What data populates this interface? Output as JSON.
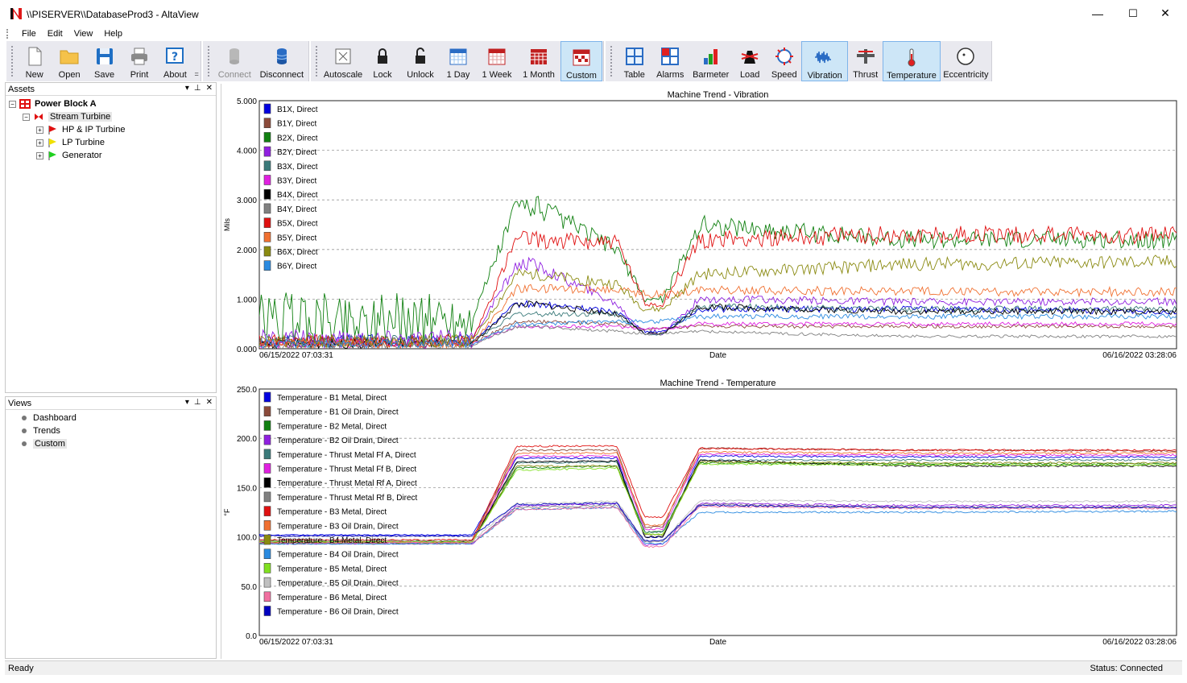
{
  "window": {
    "title": "\\\\PISERVER\\\\DatabaseProd3 - AltaView",
    "minimize": "—",
    "maximize": "☐",
    "close": "✕"
  },
  "menu": [
    "File",
    "Edit",
    "View",
    "Help"
  ],
  "toolbar": {
    "file_group": [
      {
        "label": "New",
        "icon": "new-document-icon"
      },
      {
        "label": "Open",
        "icon": "folder-icon"
      },
      {
        "label": "Save",
        "icon": "floppy-icon"
      },
      {
        "label": "Print",
        "icon": "printer-icon"
      },
      {
        "label": "About",
        "icon": "help-icon"
      }
    ],
    "overflow": "=",
    "connection_group": [
      {
        "label": "Connect",
        "icon": "database-icon",
        "disabled": true
      },
      {
        "label": "Disconnect",
        "icon": "database-icon",
        "disabled": false
      }
    ],
    "view_group": [
      {
        "label": "Autoscale",
        "icon": "autoscale-icon"
      },
      {
        "label": "Lock",
        "icon": "lock-icon"
      },
      {
        "label": "Unlock",
        "icon": "unlock-icon"
      },
      {
        "label": "1 Day",
        "icon": "calendar-day-icon"
      },
      {
        "label": "1 Week",
        "icon": "calendar-week-icon"
      },
      {
        "label": "1 Month",
        "icon": "calendar-month-icon"
      },
      {
        "label": "Custom",
        "icon": "calendar-custom-icon",
        "active": true
      }
    ],
    "display_group": [
      {
        "label": "Table",
        "icon": "table-icon"
      },
      {
        "label": "Alarms",
        "icon": "alarms-icon"
      },
      {
        "label": "Barmeter",
        "icon": "barmeter-icon"
      },
      {
        "label": "Load",
        "icon": "load-icon"
      },
      {
        "label": "Speed",
        "icon": "speed-icon"
      },
      {
        "label": "Vibration",
        "icon": "vibration-icon",
        "active": true
      },
      {
        "label": "Thrust",
        "icon": "thrust-icon"
      },
      {
        "label": "Temperature",
        "icon": "thermometer-icon",
        "active": true
      },
      {
        "label": "Eccentricity",
        "icon": "eccentricity-icon"
      }
    ]
  },
  "assets_panel": {
    "title": "Assets",
    "tree": [
      {
        "label": "Power Block A",
        "level": 0,
        "expander": "−",
        "color": "#e01010",
        "bold": true
      },
      {
        "label": "Stream Turbine",
        "level": 1,
        "expander": "−",
        "color": "#e01010",
        "selected": true
      },
      {
        "label": "HP & IP Turbine",
        "level": 2,
        "expander": "+",
        "color": "#e01010"
      },
      {
        "label": "LP Turbine",
        "level": 2,
        "expander": "+",
        "color": "#f0e000"
      },
      {
        "label": "Generator",
        "level": 2,
        "expander": "+",
        "color": "#20d020"
      }
    ]
  },
  "views_panel": {
    "title": "Views",
    "items": [
      "Dashboard",
      "Trends",
      "Custom"
    ]
  },
  "panel_controls": {
    "dropdown": "▾",
    "pin": "📌",
    "close": "✕"
  },
  "charts": {
    "vibration": {
      "title": "Machine Trend - Vibration",
      "ylabel": "Mils",
      "xlabel": "Date",
      "x_start": "06/15/2022 07:03:31",
      "x_end": "06/16/2022 03:28:06",
      "yticks": [
        "5.000",
        "4.000",
        "3.000",
        "2.000",
        "1.000",
        "0.000"
      ]
    },
    "temperature": {
      "title": "Machine Trend - Temperature",
      "ylabel": "°F",
      "xlabel": "Date",
      "x_start": "06/15/2022 07:03:31",
      "x_end": "06/16/2022 03:28:06",
      "yticks": [
        "250.0",
        "200.0",
        "150.0",
        "100.0",
        "50.0",
        "0.0"
      ]
    }
  },
  "chart_data": [
    {
      "type": "line",
      "title": "Machine Trend - Vibration",
      "xlabel": "Date",
      "ylabel": "Mils",
      "ylim": [
        0,
        5
      ],
      "x_range": [
        "06/15/2022 07:03:31",
        "06/16/2022 03:28:06"
      ],
      "grid": "horizontal-dashed",
      "legend": "top-left",
      "series": [
        {
          "name": "B1X, Direct",
          "color": "#0000e0",
          "values": [
            0.15,
            0.9,
            0.75,
            0.35,
            0.8,
            0.8,
            0.75
          ]
        },
        {
          "name": "B1Y, Direct",
          "color": "#8b4a3a",
          "values": [
            0.12,
            0.55,
            0.5,
            0.4,
            0.45,
            0.45,
            0.45
          ]
        },
        {
          "name": "B2X, Direct",
          "color": "#108010",
          "values": [
            0.6,
            2.9,
            2.0,
            1.0,
            2.5,
            2.2,
            2.2
          ]
        },
        {
          "name": "B2Y, Direct",
          "color": "#9020e0",
          "values": [
            0.2,
            1.7,
            0.9,
            0.3,
            1.0,
            0.95,
            0.95
          ]
        },
        {
          "name": "B3X, Direct",
          "color": "#3a7a7a",
          "values": [
            0.15,
            0.7,
            0.7,
            0.3,
            0.85,
            0.8,
            0.8
          ]
        },
        {
          "name": "B3Y, Direct",
          "color": "#e020e0",
          "values": [
            0.1,
            0.45,
            0.45,
            0.4,
            0.5,
            0.5,
            0.5
          ]
        },
        {
          "name": "B4X, Direct",
          "color": "#000000",
          "values": [
            0.1,
            0.9,
            0.7,
            0.3,
            0.85,
            0.75,
            0.75
          ]
        },
        {
          "name": "B4Y, Direct",
          "color": "#808080",
          "values": [
            0.08,
            0.45,
            0.35,
            0.3,
            0.35,
            0.25,
            0.25
          ]
        },
        {
          "name": "B5X, Direct",
          "color": "#e01010",
          "values": [
            0.15,
            2.2,
            2.15,
            0.9,
            2.2,
            2.3,
            2.3
          ]
        },
        {
          "name": "B5Y, Direct",
          "color": "#f07030",
          "values": [
            0.1,
            1.2,
            1.2,
            1.1,
            1.2,
            1.15,
            1.15
          ]
        },
        {
          "name": "B6X, Direct",
          "color": "#8a8a10",
          "values": [
            0.15,
            1.5,
            1.3,
            0.8,
            1.5,
            1.7,
            1.75
          ]
        },
        {
          "name": "B6Y, Direct",
          "color": "#2a8ae0",
          "values": [
            0.1,
            0.5,
            0.55,
            0.55,
            0.65,
            0.65,
            0.65
          ]
        }
      ]
    },
    {
      "type": "line",
      "title": "Machine Trend - Temperature",
      "xlabel": "Date",
      "ylabel": "°F",
      "ylim": [
        0,
        250
      ],
      "x_range": [
        "06/15/2022 07:03:31",
        "06/16/2022 03:28:06"
      ],
      "grid": "horizontal-dashed",
      "legend": "top-left",
      "series": [
        {
          "name": "Temperature - B1 Metal, Direct",
          "color": "#0000e0",
          "values": [
            102,
            180,
            180,
            100,
            182,
            181,
            181
          ]
        },
        {
          "name": "Temperature - B1 Oil Drain, Direct",
          "color": "#8b4a3a",
          "values": [
            96,
            188,
            188,
            110,
            190,
            188,
            187
          ]
        },
        {
          "name": "Temperature - B2 Metal, Direct",
          "color": "#108010",
          "values": [
            96,
            170,
            172,
            105,
            175,
            174,
            174
          ]
        },
        {
          "name": "Temperature - B2 Oil Drain, Direct",
          "color": "#9020e0",
          "values": [
            93,
            132,
            134,
            92,
            134,
            132,
            132
          ]
        },
        {
          "name": "Temperature - Thrust Metal Ff A, Direct",
          "color": "#3a7a7a",
          "values": [
            95,
            175,
            176,
            105,
            178,
            178,
            178
          ]
        },
        {
          "name": "Temperature - Thrust Metal Ff B, Direct",
          "color": "#e020e0",
          "values": [
            94,
            182,
            182,
            108,
            184,
            183,
            183
          ]
        },
        {
          "name": "Temperature - Thrust Metal Rf A, Direct",
          "color": "#000000",
          "values": [
            95,
            176,
            177,
            100,
            178,
            172,
            172
          ]
        },
        {
          "name": "Temperature - Thrust Metal Rf B, Direct",
          "color": "#808080",
          "values": [
            93,
            130,
            132,
            95,
            133,
            130,
            130
          ]
        },
        {
          "name": "Temperature - B3 Metal, Direct",
          "color": "#e01010",
          "values": [
            97,
            192,
            192,
            120,
            190,
            188,
            188
          ]
        },
        {
          "name": "Temperature - B3 Oil Drain, Direct",
          "color": "#f07030",
          "values": [
            95,
            185,
            185,
            112,
            186,
            185,
            185
          ]
        },
        {
          "name": "Temperature - B4 Metal, Direct",
          "color": "#8a8a10",
          "values": [
            94,
            172,
            172,
            102,
            176,
            175,
            175
          ]
        },
        {
          "name": "Temperature - B4 Oil Drain, Direct",
          "color": "#2a8ae0",
          "values": [
            93,
            128,
            130,
            93,
            125,
            125,
            126
          ]
        },
        {
          "name": "Temperature - B5 Metal, Direct",
          "color": "#80e020",
          "values": [
            95,
            168,
            170,
            103,
            174,
            173,
            173
          ]
        },
        {
          "name": "Temperature - B5 Oil Drain, Direct",
          "color": "#c0c0c0",
          "values": [
            96,
            134,
            136,
            96,
            137,
            136,
            136
          ]
        },
        {
          "name": "Temperature - B6 Metal, Direct",
          "color": "#f070a0",
          "values": [
            94,
            128,
            130,
            90,
            131,
            129,
            129
          ]
        },
        {
          "name": "Temperature - B6 Oil Drain, Direct",
          "color": "#0000c0",
          "values": [
            101,
            133,
            134,
            96,
            132,
            130,
            130
          ]
        }
      ]
    }
  ],
  "status": {
    "left": "Ready",
    "right": "Status: Connected"
  }
}
